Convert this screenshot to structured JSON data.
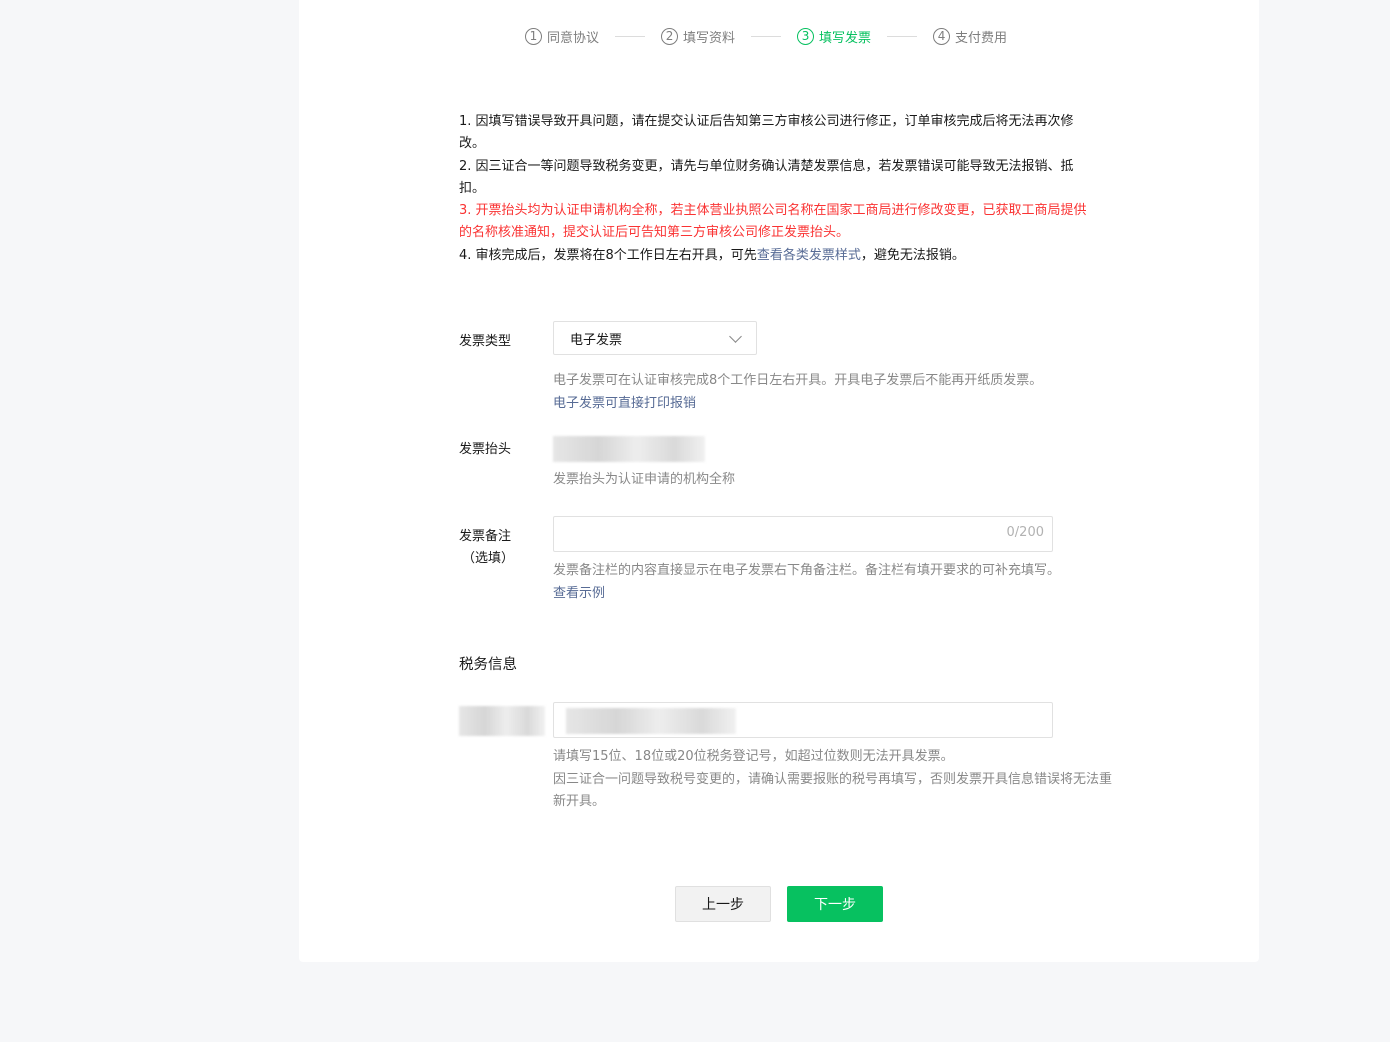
{
  "steps": [
    {
      "num": "1",
      "label": "同意协议",
      "active": false
    },
    {
      "num": "2",
      "label": "填写资料",
      "active": false
    },
    {
      "num": "3",
      "label": "填写发票",
      "active": true
    },
    {
      "num": "4",
      "label": "支付费用",
      "active": false
    }
  ],
  "notes": {
    "n1": "1. 因填写错误导致开具问题，请在提交认证后告知第三方审核公司进行修正，订单审核完成后将无法再次修改。",
    "n2": "2. 因三证合一等问题导致税务变更，请先与单位财务确认清楚发票信息，若发票错误可能导致无法报销、抵扣。",
    "n3": "3. 开票抬头均为认证申请机构全称，若主体营业执照公司名称在国家工商局进行修改变更，已获取工商局提供的名称核准通知，提交认证后可告知第三方审核公司修正发票抬头。",
    "n4_pre": "4. 审核完成后，发票将在8个工作日左右开具，可先",
    "n4_link": "查看各类发票样式",
    "n4_post": "，避免无法报销。"
  },
  "invoice_type": {
    "label": "发票类型",
    "value": "电子发票",
    "hint": "电子发票可在认证审核完成8个工作日左右开具。开具电子发票后不能再开纸质发票。",
    "hint_link": "电子发票可直接打印报销"
  },
  "invoice_title": {
    "label": "发票抬头",
    "hint": "发票抬头为认证申请的机构全称"
  },
  "invoice_remark": {
    "label": "发票备注",
    "label_sub": "（选填）",
    "counter": "0/200",
    "hint": "发票备注栏的内容直接显示在电子发票右下角备注栏。备注栏有填开要求的可补充填写。",
    "hint_link": "查看示例"
  },
  "tax": {
    "section_title": "税务信息",
    "hint1": "请填写15位、18位或20位税务登记号，如超过位数则无法开具发票。",
    "hint2": "因三证合一问题导致税号变更的，请确认需要报账的税号再填写，否则发票开具信息错误将无法重新开具。"
  },
  "buttons": {
    "prev": "上一步",
    "next": "下一步"
  },
  "colors": {
    "accent": "#07c160",
    "warning": "#fa3333",
    "link": "#576b95"
  }
}
